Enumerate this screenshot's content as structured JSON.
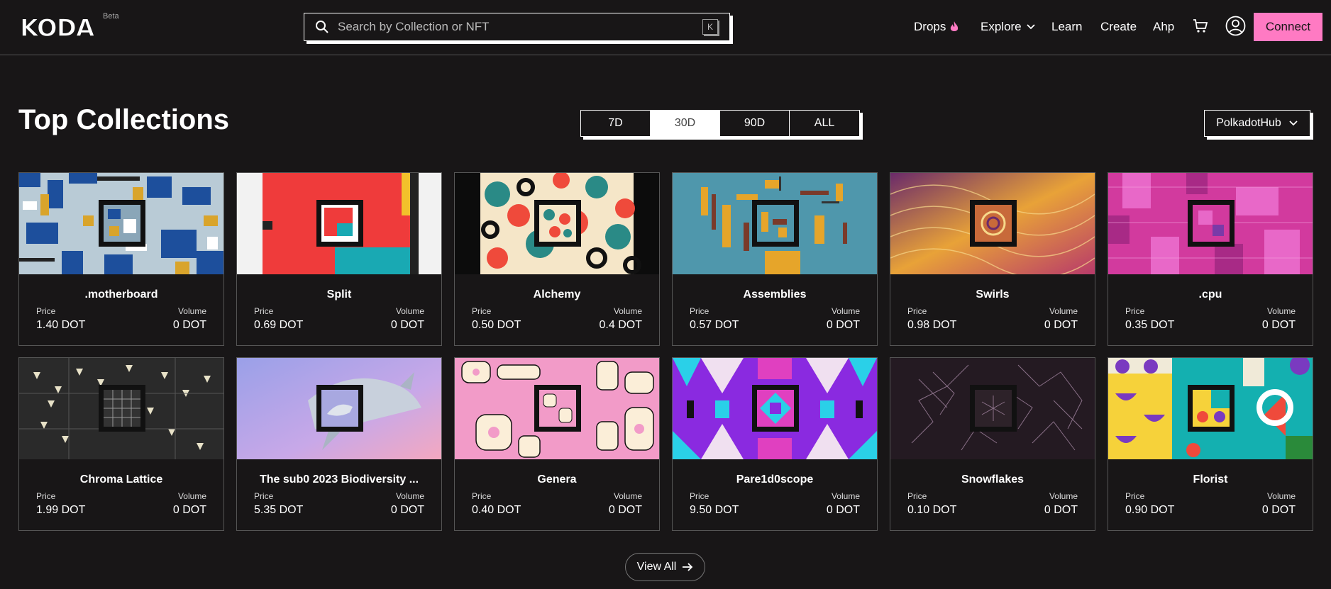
{
  "brand": {
    "logo_text": "KODA",
    "badge": "Beta"
  },
  "search": {
    "placeholder": "Search by Collection or NFT",
    "shortcut": "K"
  },
  "nav": {
    "drops": "Drops",
    "explore": "Explore",
    "learn": "Learn",
    "create": "Create",
    "ahp": "Ahp",
    "connect": "Connect"
  },
  "colors": {
    "accent": "#ff7ac3",
    "background": "#181617"
  },
  "main": {
    "title": "Top Collections",
    "periods": [
      "7D",
      "30D",
      "90D",
      "ALL"
    ],
    "active_period": "30D",
    "chain": "PolkadotHub",
    "price_label": "Price",
    "volume_label": "Volume",
    "view_all": "View All"
  },
  "collections": [
    {
      "name": ".motherboard",
      "price": "1.40 DOT",
      "volume": "0 DOT"
    },
    {
      "name": "Split",
      "price": "0.69 DOT",
      "volume": "0 DOT"
    },
    {
      "name": "Alchemy",
      "price": "0.50 DOT",
      "volume": "0.4 DOT"
    },
    {
      "name": "Assemblies",
      "price": "0.57 DOT",
      "volume": "0 DOT"
    },
    {
      "name": "Swirls",
      "price": "0.98 DOT",
      "volume": "0 DOT"
    },
    {
      "name": ".cpu",
      "price": "0.35 DOT",
      "volume": "0 DOT"
    },
    {
      "name": "Chroma Lattice",
      "price": "1.99 DOT",
      "volume": "0 DOT"
    },
    {
      "name": "The sub0 2023 Biodiversity ...",
      "price": "5.35 DOT",
      "volume": "0 DOT"
    },
    {
      "name": "Genera",
      "price": "0.40 DOT",
      "volume": "0 DOT"
    },
    {
      "name": "Pare1d0scope",
      "price": "9.50 DOT",
      "volume": "0 DOT"
    },
    {
      "name": "Snowflakes",
      "price": "0.10 DOT",
      "volume": "0 DOT"
    },
    {
      "name": "Florist",
      "price": "0.90 DOT",
      "volume": "0 DOT"
    }
  ]
}
